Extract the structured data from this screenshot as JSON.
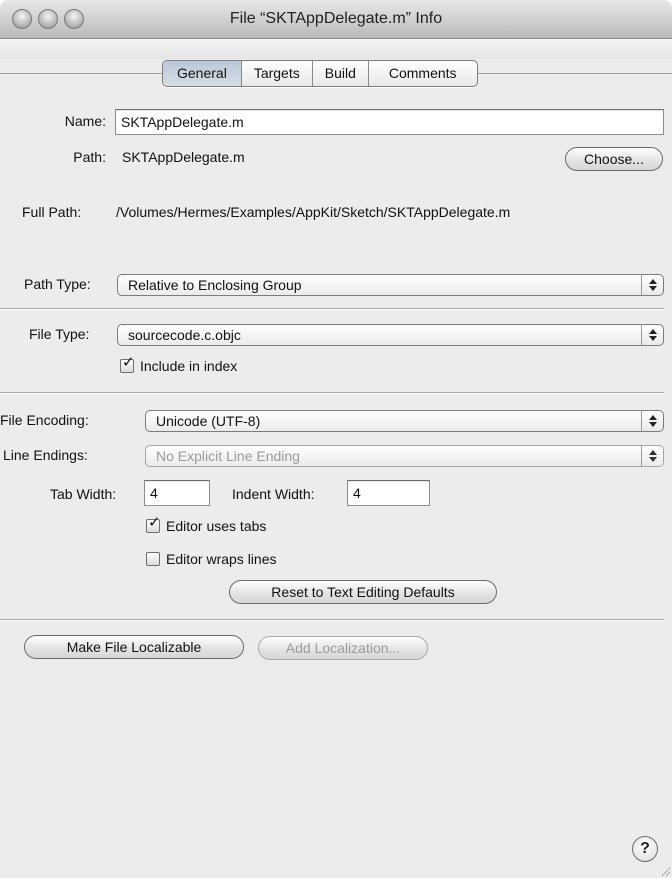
{
  "window": {
    "title": "File “SKTAppDelegate.m” Info"
  },
  "tabs": [
    {
      "label": "General",
      "active": true
    },
    {
      "label": "Targets",
      "active": false
    },
    {
      "label": "Build",
      "active": false
    },
    {
      "label": "Comments",
      "active": false
    }
  ],
  "name": {
    "label": "Name:",
    "value": "SKTAppDelegate.m"
  },
  "path": {
    "label": "Path:",
    "value": "SKTAppDelegate.m",
    "choose_label": "Choose..."
  },
  "full_path": {
    "label": "Full Path:",
    "value": "/Volumes/Hermes/Examples/AppKit/Sketch/SKTAppDelegate.m"
  },
  "path_type": {
    "label": "Path Type:",
    "value": "Relative to Enclosing Group"
  },
  "file_type": {
    "label": "File Type:",
    "value": "sourcecode.c.objc",
    "include_in_index_label": "Include in index",
    "include_in_index": true
  },
  "file_encoding": {
    "label": "File Encoding:",
    "value": "Unicode (UTF-8)"
  },
  "line_endings": {
    "label": "Line Endings:",
    "value": "No Explicit Line Ending"
  },
  "tab_width": {
    "label": "Tab Width:",
    "value": "4"
  },
  "indent_width": {
    "label": "Indent Width:",
    "value": "4"
  },
  "editor_uses_tabs": {
    "label": "Editor uses tabs",
    "checked": true
  },
  "editor_wraps_lines": {
    "label": "Editor wraps lines",
    "checked": false
  },
  "reset_button": {
    "label": "Reset to Text Editing Defaults"
  },
  "make_localizable_button": {
    "label": "Make File Localizable"
  },
  "add_localization_button": {
    "label": "Add Localization..."
  },
  "help_button": {
    "label": "?"
  }
}
